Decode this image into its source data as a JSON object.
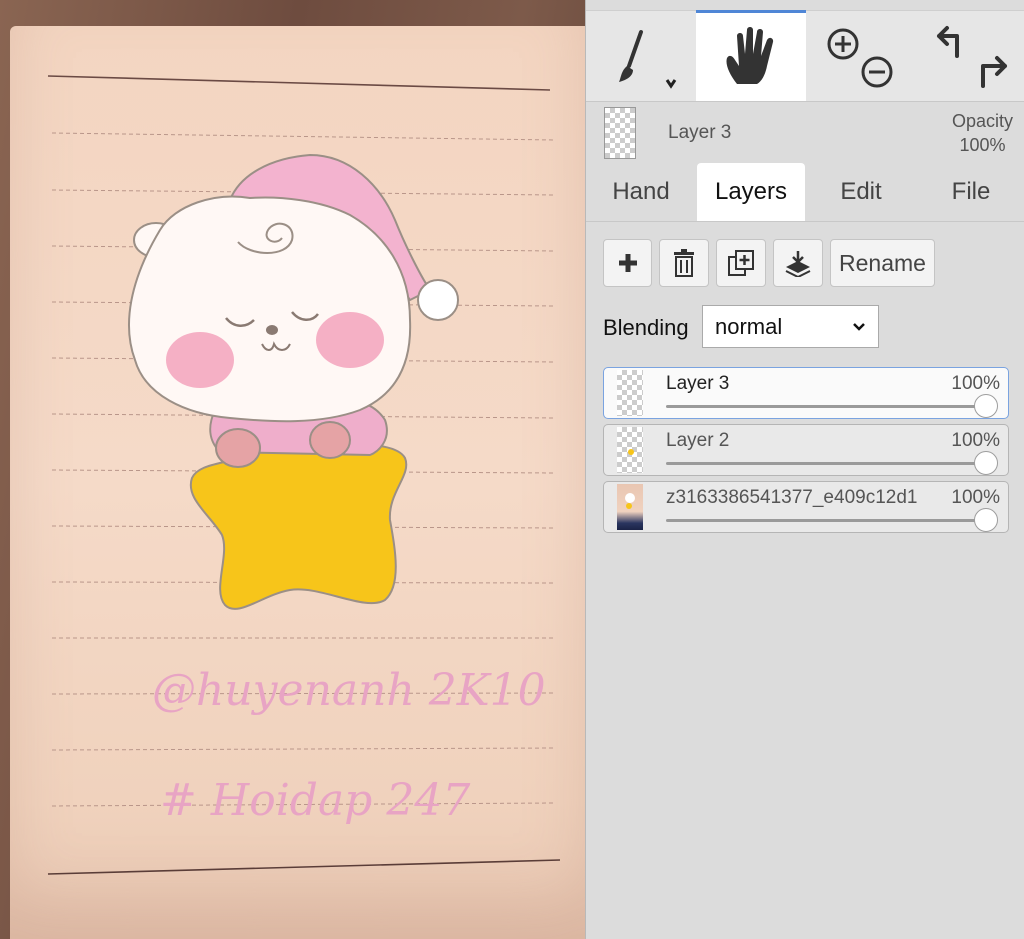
{
  "canvas": {
    "handwriting_line1": "@huyenanh 2K10",
    "handwriting_line2": "# Hoidap 247"
  },
  "toolbar": {
    "tools": [
      {
        "icon": "brush-icon"
      },
      {
        "icon": "hand-icon",
        "active": true
      },
      {
        "icon": "zoom-icon"
      },
      {
        "icon": "undo-redo-icon"
      }
    ]
  },
  "header": {
    "layer_name": "Layer 3",
    "opacity_label": "Opacity",
    "opacity_value": "100%"
  },
  "tabs": [
    {
      "label": "Hand"
    },
    {
      "label": "Layers",
      "active": true
    },
    {
      "label": "Edit"
    },
    {
      "label": "File"
    }
  ],
  "actions": {
    "rename_label": "Rename"
  },
  "blending": {
    "label": "Blending",
    "value": "normal"
  },
  "layers": [
    {
      "name": "Layer 3",
      "opacity": "100%",
      "opacity_fraction": 1.0,
      "active": true
    },
    {
      "name": "Layer 2",
      "opacity": "100%",
      "opacity_fraction": 1.0,
      "active": false
    },
    {
      "name": "z3163386541377_e409c12d1",
      "opacity": "100%",
      "opacity_fraction": 1.0,
      "active": false
    }
  ],
  "colors": {
    "accent": "#4f86d6",
    "star": "#f7c51a",
    "hat": "#f3b3cf",
    "handwriting": "#e8a4c4"
  }
}
